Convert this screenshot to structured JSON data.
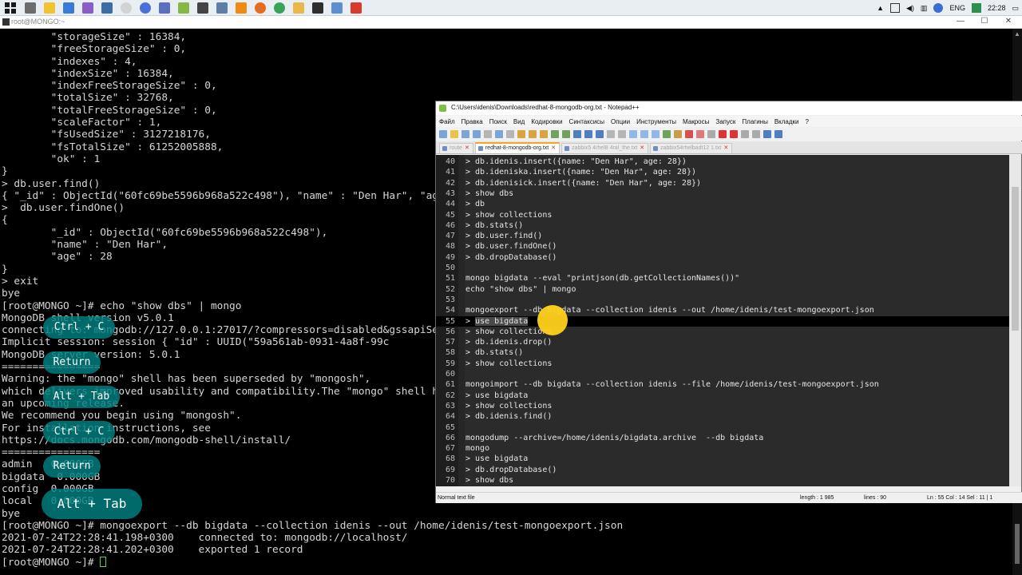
{
  "taskbar": {
    "tray": {
      "language": "ENG",
      "time": "22:28"
    }
  },
  "terminal": {
    "title": "root@MONGO:~",
    "lines": [
      "        \"storageSize\" : 16384,",
      "        \"freeStorageSize\" : 0,",
      "        \"indexes\" : 4,",
      "        \"indexSize\" : 16384,",
      "        \"indexFreeStorageSize\" : 0,",
      "        \"totalSize\" : 32768,",
      "        \"totalFreeStorageSize\" : 0,",
      "        \"scaleFactor\" : 1,",
      "        \"fsUsedSize\" : 3127218176,",
      "        \"fsTotalSize\" : 61252005888,",
      "        \"ok\" : 1",
      "}",
      "> db.user.find()",
      "{ \"_id\" : ObjectId(\"60fc69be5596b968a522c498\"), \"name\" : \"Den Har\", \"age\" : 28 }",
      ">  db.user.findOne()",
      "{",
      "        \"_id\" : ObjectId(\"60fc69be5596b968a522c498\"),",
      "        \"name\" : \"Den Har\",",
      "        \"age\" : 28",
      "}",
      "> exit",
      "bye",
      "[root@MONGO ~]# echo \"show dbs\" | mongo",
      "MongoDB shell version v5.0.1",
      "connecting to: mongodb://127.0.0.1:27017/?compressors=disabled&gssapiServiceName=mongodb",
      "Implicit session: session { \"id\" : UUID(\"59a561ab-0931-4a8f-99c",
      "MongoDB server version: 5.0.1",
      "================",
      "Warning: the \"mongo\" shell has been superseded by \"mongosh\",",
      "which delivers improved usability and compatibility.The \"mongo\" shell has been deprecated and will be removed in",
      "an upcoming release.",
      "We recommend you begin using \"mongosh\".",
      "For installation instructions, see",
      "https://docs.mongodb.com/mongodb-shell/install/",
      "================",
      "admin   0.000GB",
      "bigdata  0.000GB",
      "config  0.000GB",
      "local   0.000GB",
      "bye",
      "[root@MONGO ~]# mongoexport --db bigdata --collection idenis --out /home/idenis/test-mongoexport.json",
      "2021-07-24T22:28:41.198+0300    connected to: mongodb://localhost/",
      "2021-07-24T22:28:41.202+0300    exported 1 record",
      "[root@MONGO ~]# "
    ]
  },
  "badges": {
    "ctrl_c": "Ctrl + C",
    "return": "Return",
    "alt_tab": "Alt + Tab"
  },
  "npp": {
    "title": "C:\\Users\\idenis\\Downloads\\redhat-8-mongodb-org.txt - Notepad++",
    "menu": [
      "Файл",
      "Правка",
      "Поиск",
      "Вид",
      "Кодировки",
      "Синтаксисы",
      "Опции",
      "Инструменты",
      "Макросы",
      "Запуск",
      "Плагины",
      "Вкладки",
      "?"
    ],
    "tabs": [
      "route",
      "redhat-8-mongodb-org.txt",
      "zabbix5 4rhel8 4ral_the.txt",
      "zabbix54rhelbadt12 1.txt"
    ],
    "active_tab": 1,
    "editor_lines": [
      {
        "n": "40",
        "t": "> db.idenis.insert({name: \"Den Har\", age: 28})"
      },
      {
        "n": "41",
        "t": "> db.ideniska.insert({name: \"Den Har\", age: 28})"
      },
      {
        "n": "42",
        "t": "> db.idenisick.insert({name: \"Den Har\", age: 28})"
      },
      {
        "n": "43",
        "t": "> show dbs"
      },
      {
        "n": "44",
        "t": "> db"
      },
      {
        "n": "45",
        "t": "> show collections"
      },
      {
        "n": "46",
        "t": "> db.stats()"
      },
      {
        "n": "47",
        "t": "> db.user.find()"
      },
      {
        "n": "48",
        "t": "> db.user.findOne()"
      },
      {
        "n": "49",
        "t": "> db.dropDatabase()"
      },
      {
        "n": "50",
        "t": ""
      },
      {
        "n": "51",
        "t": "mongo bigdata --eval \"printjson(db.getCollectionNames())\""
      },
      {
        "n": "52",
        "t": "echo \"show dbs\" | mongo"
      },
      {
        "n": "53",
        "t": ""
      },
      {
        "n": "54",
        "t": "mongoexport --db bigdata --collection idenis --out /home/idenis/test-mongoexport.json"
      },
      {
        "n": "55",
        "t": "> use bigdata"
      },
      {
        "n": "56",
        "t": "> show collections"
      },
      {
        "n": "57",
        "t": "> db.idenis.drop()"
      },
      {
        "n": "58",
        "t": "> db.stats()"
      },
      {
        "n": "59",
        "t": "> show collections"
      },
      {
        "n": "60",
        "t": ""
      },
      {
        "n": "61",
        "t": "mongoimport --db bigdata --collection idenis --file /home/idenis/test-mongoexport.json"
      },
      {
        "n": "62",
        "t": "> use bigdata"
      },
      {
        "n": "63",
        "t": "> show collections"
      },
      {
        "n": "64",
        "t": "> db.idenis.find()"
      },
      {
        "n": "65",
        "t": ""
      },
      {
        "n": "66",
        "t": "mongodump --archive=/home/idenis/bigdata.archive  --db bigdata"
      },
      {
        "n": "67",
        "t": "mongo"
      },
      {
        "n": "68",
        "t": "> use bigdata"
      },
      {
        "n": "69",
        "t": "> db.dropDatabase()"
      },
      {
        "n": "70",
        "t": "> show dbs"
      }
    ],
    "current_line_index": 15,
    "status": {
      "type": "Normal text file",
      "length": "length : 1 985",
      "lines": "lines : 90",
      "position": "Ln : 55    Col : 14    Sel : 11 | 1"
    }
  }
}
